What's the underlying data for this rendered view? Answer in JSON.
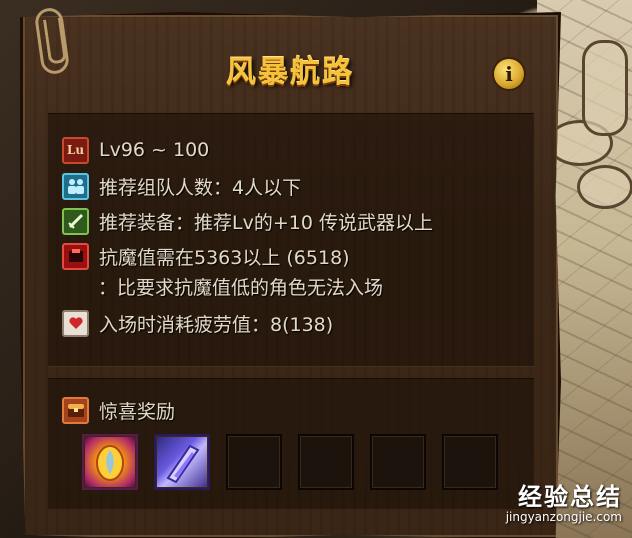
{
  "dialog": {
    "title": "风暴航路",
    "info_icon": "info-icon",
    "info_glyph": "i"
  },
  "requirements": {
    "level": {
      "icon": "level-icon",
      "icon_text": "Lu",
      "text": "Lv96 ~ 100"
    },
    "party": {
      "icon": "party-icon",
      "text": "推荐组队人数：4人以下"
    },
    "equipment": {
      "icon": "sword-icon",
      "text": "推荐装备：推荐Lv的+10 传说武器以上"
    },
    "anti_evil": {
      "icon": "anti-evil-icon",
      "text": "抗魔值需在5363以上 (6518)",
      "note": "：比要求抗魔值低的角色无法入场"
    },
    "fatigue": {
      "icon": "fatigue-icon",
      "text": "入场时消耗疲劳值：8(138)"
    }
  },
  "rewards": {
    "icon": "treasure-chest-icon",
    "label": "惊喜奖励",
    "slots": [
      {
        "icon": "golden-orb-item-icon",
        "filled": true
      },
      {
        "icon": "crystal-shard-item-icon",
        "filled": true
      },
      {
        "icon": "empty-slot",
        "filled": false
      },
      {
        "icon": "empty-slot",
        "filled": false
      },
      {
        "icon": "empty-slot",
        "filled": false
      },
      {
        "icon": "empty-slot",
        "filled": false
      }
    ]
  },
  "watermark": {
    "line1": "经验总结",
    "line2": "jingyanzongjie.com"
  },
  "colors": {
    "title": "#f5c33b",
    "text": "#e2d9c7",
    "board": "#3d2818"
  }
}
